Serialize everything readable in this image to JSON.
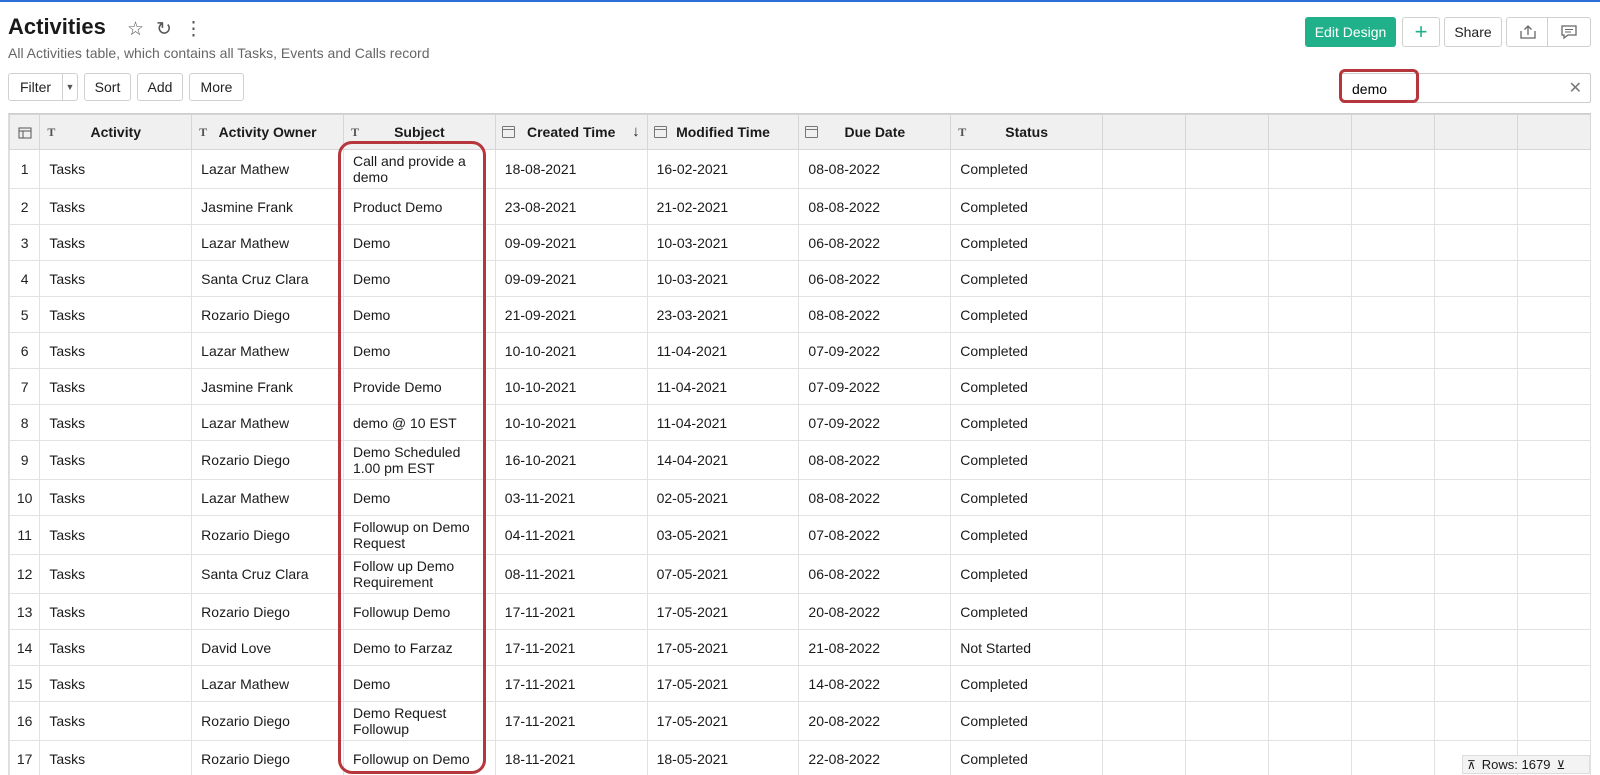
{
  "header": {
    "title": "Activities",
    "subtitle": "All Activities table, which contains all Tasks, Events and Calls record",
    "edit_design": "Edit Design",
    "add": "+",
    "share": "Share"
  },
  "toolbar": {
    "filter": "Filter",
    "sort": "Sort",
    "add": "Add",
    "more": "More"
  },
  "search": {
    "value": "demo"
  },
  "table": {
    "columns": [
      "Activity",
      "Activity Owner",
      "Subject",
      "Created Time",
      "Modified Time",
      "Due Date",
      "Status"
    ],
    "rows": [
      [
        "1",
        "Tasks",
        "Lazar Mathew",
        "Call and provide a demo",
        "18-08-2021",
        "16-02-2021",
        "08-08-2022",
        "Completed"
      ],
      [
        "2",
        "Tasks",
        "Jasmine Frank",
        "Product Demo",
        "23-08-2021",
        "21-02-2021",
        "08-08-2022",
        "Completed"
      ],
      [
        "3",
        "Tasks",
        "Lazar Mathew",
        "Demo",
        "09-09-2021",
        "10-03-2021",
        "06-08-2022",
        "Completed"
      ],
      [
        "4",
        "Tasks",
        "Santa Cruz Clara",
        "Demo",
        "09-09-2021",
        "10-03-2021",
        "06-08-2022",
        "Completed"
      ],
      [
        "5",
        "Tasks",
        "Rozario Diego",
        "Demo",
        "21-09-2021",
        "23-03-2021",
        "08-08-2022",
        "Completed"
      ],
      [
        "6",
        "Tasks",
        "Lazar Mathew",
        "Demo",
        "10-10-2021",
        "11-04-2021",
        "07-09-2022",
        "Completed"
      ],
      [
        "7",
        "Tasks",
        "Jasmine Frank",
        "Provide Demo",
        "10-10-2021",
        "11-04-2021",
        "07-09-2022",
        "Completed"
      ],
      [
        "8",
        "Tasks",
        "Lazar Mathew",
        "demo @ 10 EST",
        "10-10-2021",
        "11-04-2021",
        "07-09-2022",
        "Completed"
      ],
      [
        "9",
        "Tasks",
        "Rozario Diego",
        "Demo Scheduled 1.00 pm EST",
        "16-10-2021",
        "14-04-2021",
        "08-08-2022",
        "Completed"
      ],
      [
        "10",
        "Tasks",
        "Lazar Mathew",
        "Demo",
        "03-11-2021",
        "02-05-2021",
        "08-08-2022",
        "Completed"
      ],
      [
        "11",
        "Tasks",
        "Rozario Diego",
        "Followup on Demo Request",
        "04-11-2021",
        "03-05-2021",
        "07-08-2022",
        "Completed"
      ],
      [
        "12",
        "Tasks",
        "Santa Cruz Clara",
        "Follow up Demo Requirement",
        "08-11-2021",
        "07-05-2021",
        "06-08-2022",
        "Completed"
      ],
      [
        "13",
        "Tasks",
        "Rozario Diego",
        "Followup Demo",
        "17-11-2021",
        "17-05-2021",
        "20-08-2022",
        "Completed"
      ],
      [
        "14",
        "Tasks",
        "David Love",
        "Demo to Farzaz",
        "17-11-2021",
        "17-05-2021",
        "21-08-2022",
        "Not Started"
      ],
      [
        "15",
        "Tasks",
        "Lazar Mathew",
        "Demo",
        "17-11-2021",
        "17-05-2021",
        "14-08-2022",
        "Completed"
      ],
      [
        "16",
        "Tasks",
        "Rozario Diego",
        "Demo Request Followup",
        "17-11-2021",
        "17-05-2021",
        "20-08-2022",
        "Completed"
      ],
      [
        "17",
        "Tasks",
        "Rozario Diego",
        "Followup on Demo",
        "18-11-2021",
        "18-05-2021",
        "22-08-2022",
        "Completed"
      ]
    ]
  },
  "footer": {
    "rows_label": "Rows: 1679"
  },
  "colors": {
    "accent": "#20b18a",
    "highlight": "#b5373b"
  }
}
